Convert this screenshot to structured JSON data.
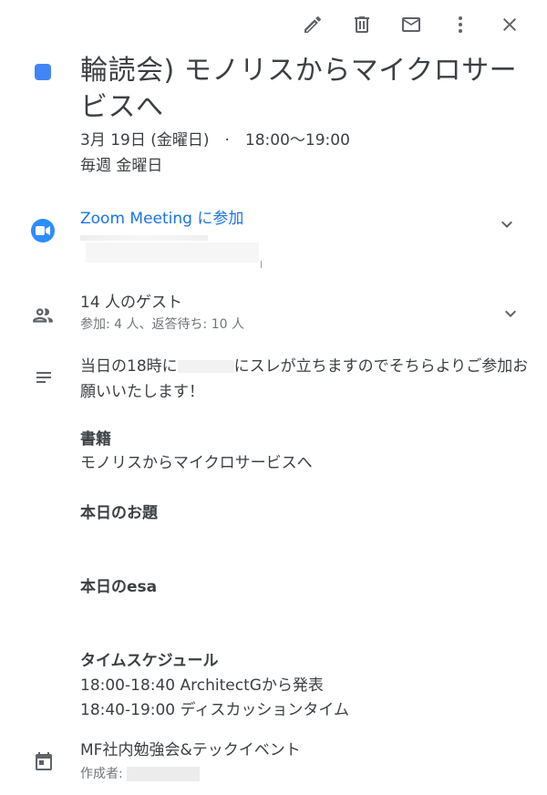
{
  "event": {
    "title": "輪読会) モノリスからマイクロサービスへ",
    "date": "3月 19日 (金曜日)　·　18:00～19:00",
    "recurrence": "毎週 金曜日",
    "color": "#4285f4"
  },
  "conference": {
    "join_label": "Zoom Meeting に参加"
  },
  "guests": {
    "title": "14 人のゲスト",
    "summary": "参加: 4 人、返答待ち: 10 人"
  },
  "description": {
    "text_before": "当日の18時に",
    "text_after": "にスレが立ちますのでそちらよりご参加お願いいたします！",
    "sections": [
      {
        "heading": "書籍",
        "lines": [
          "モノリスからマイクロサービスへ"
        ]
      },
      {
        "heading": "本日のお題",
        "lines": []
      },
      {
        "heading": "本日のesa",
        "lines": []
      },
      {
        "heading": "タイムスケジュール",
        "lines": [
          "18:00-18:40 ArchitectGから発表",
          "18:40-19:00 ディスカッションタイム"
        ]
      }
    ]
  },
  "calendar": {
    "name": "MF社内勉強会&テックイベント",
    "creator_label": "作成者:"
  },
  "toolbar": {
    "icons": [
      "edit-icon",
      "delete-icon",
      "email-icon",
      "more-icon",
      "close-icon"
    ]
  }
}
